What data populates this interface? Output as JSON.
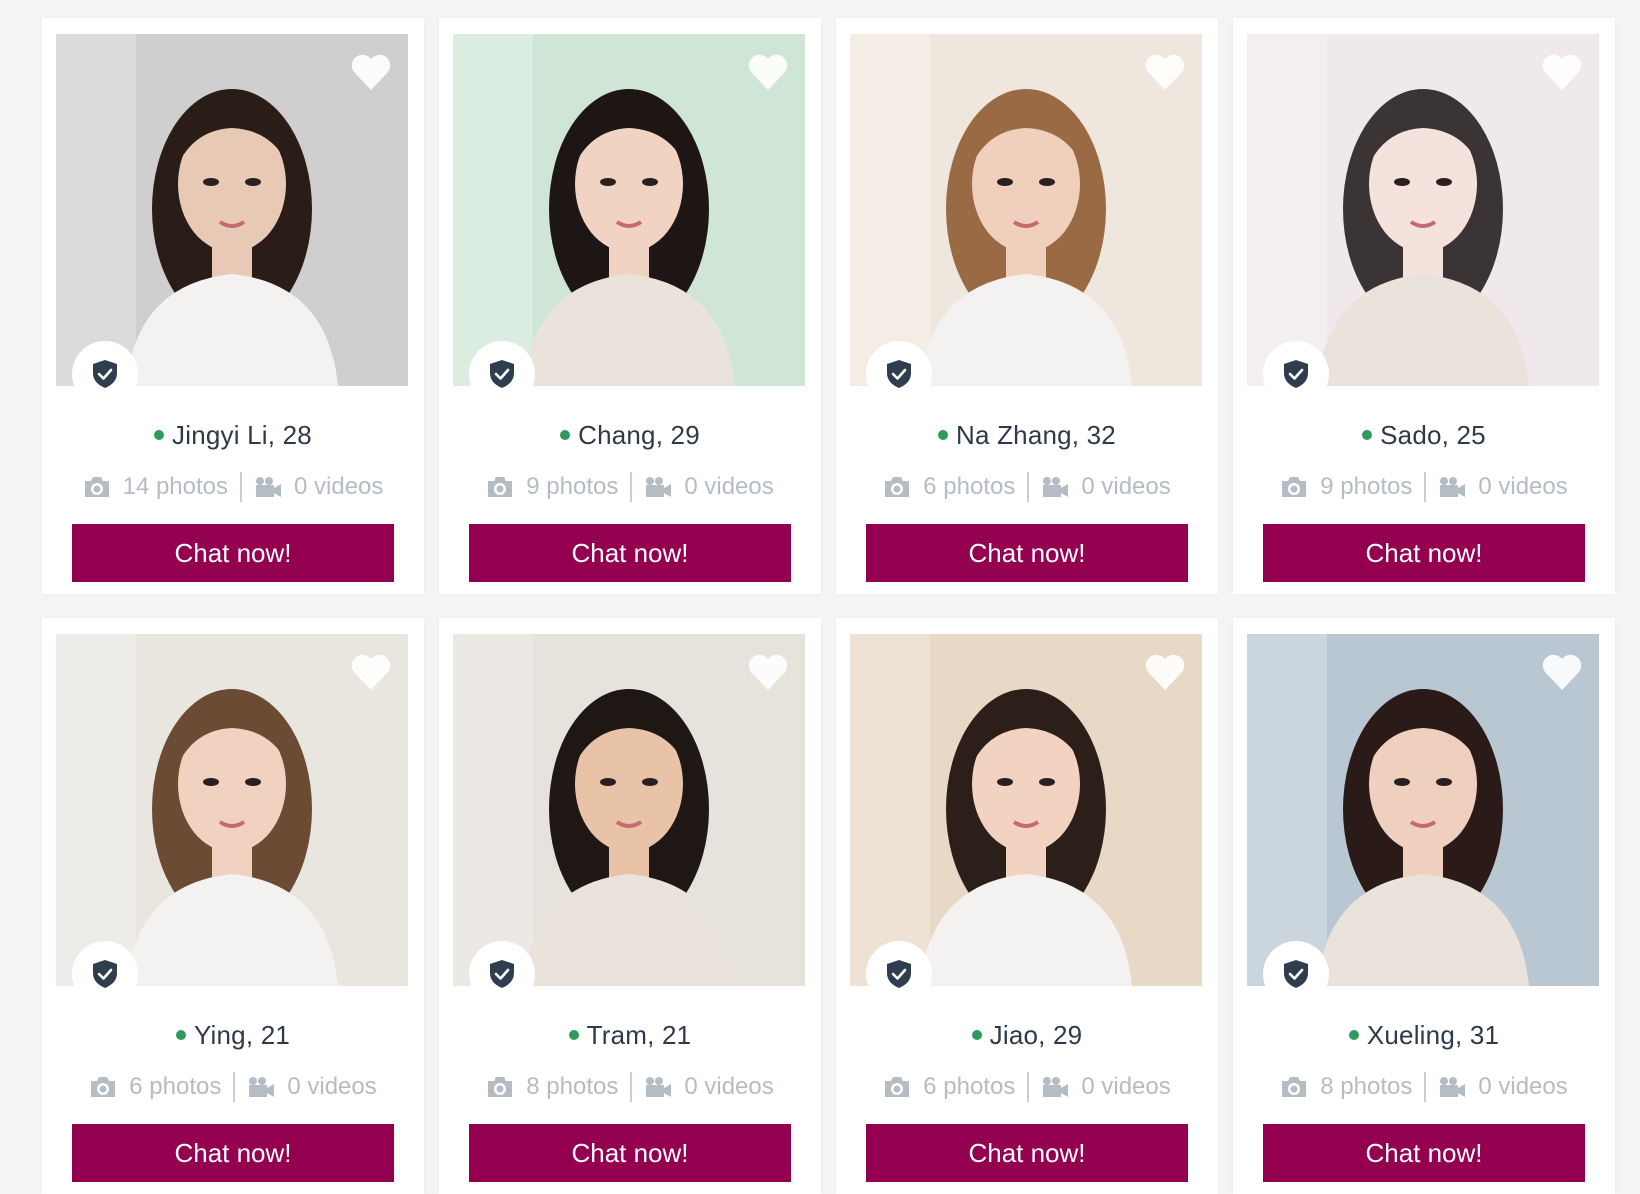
{
  "colors": {
    "accent": "#94004f",
    "online": "#2e9a5c",
    "name_text": "#2e3a4a",
    "meta_text": "#b6bcc4"
  },
  "icons": {
    "favorite": "heart-icon",
    "verified": "shield-check-icon",
    "photos": "camera-icon",
    "videos": "video-camera-icon",
    "status": "online-dot-icon"
  },
  "profiles": [
    {
      "name_age": "Jingyi Li, 28",
      "photos": "14 photos",
      "videos": "0 videos",
      "cta": "Chat now!",
      "bg": "#cfcfcf",
      "tone": "#e8c9b5",
      "hair": "#2a1c17"
    },
    {
      "name_age": "Chang, 29",
      "photos": "9 photos",
      "videos": "0 videos",
      "cta": "Chat now!",
      "bg": "#cfe6d6",
      "tone": "#f1d3c3",
      "hair": "#1d1614"
    },
    {
      "name_age": "Na Zhang, 32",
      "photos": "6 photos",
      "videos": "0 videos",
      "cta": "Chat now!",
      "bg": "#efe7de",
      "tone": "#f0cfbd",
      "hair": "#9a6a45"
    },
    {
      "name_age": "Sado, 25",
      "photos": "9 photos",
      "videos": "0 videos",
      "cta": "Chat now!",
      "bg": "#efe9ee",
      "tone": "#f6e2dd",
      "hair": "#3a3434"
    },
    {
      "name_age": "Ying, 21",
      "photos": "6 photos",
      "videos": "0 videos",
      "cta": "Chat now!",
      "bg": "#e9e6e0",
      "tone": "#f1d2c0",
      "hair": "#6b4b33"
    },
    {
      "name_age": "Tram, 21",
      "photos": "8 photos",
      "videos": "0 videos",
      "cta": "Chat now!",
      "bg": "#e6e2dc",
      "tone": "#e9c3a8",
      "hair": "#1f1714"
    },
    {
      "name_age": "Jiao, 29",
      "photos": "6 photos",
      "videos": "0 videos",
      "cta": "Chat now!",
      "bg": "#e8d9c6",
      "tone": "#f2d2c0",
      "hair": "#2c1f19"
    },
    {
      "name_age": "Xueling, 31",
      "photos": "8 photos",
      "videos": "0 videos",
      "cta": "Chat now!",
      "bg": "#b9c7d2",
      "tone": "#efcfbe",
      "hair": "#2a1a18"
    }
  ]
}
